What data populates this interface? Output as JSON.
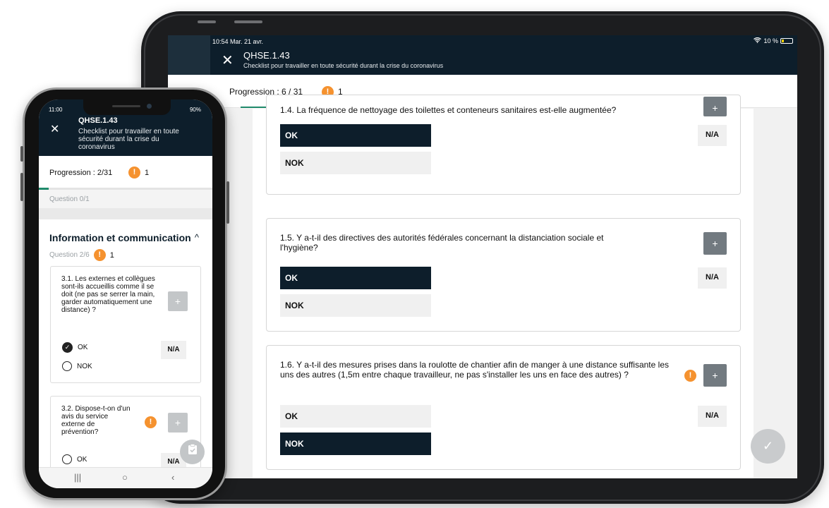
{
  "tablet": {
    "status": {
      "time_date": "10:54  Mar. 21 avr.",
      "battery": "10 %"
    },
    "header": {
      "title": "QHSE.1.43",
      "subtitle": "Checklist pour travailler en toute sécurité durant la crise du coronavirus"
    },
    "progress": {
      "label": "Progression : 6 / 31",
      "warnings": "1"
    },
    "questions": [
      {
        "text": "1.4. La fréquence de nettoyage des toilettes et conteneurs sanitaires est-elle augmentée?",
        "ok": "OK",
        "nok": "NOK",
        "na": "N/A",
        "selected": "OK"
      },
      {
        "text": "1.5. Y a-t-il des directives des autorités fédérales concernant la distanciation sociale et l'hygiène?",
        "ok": "OK",
        "nok": "NOK",
        "na": "N/A",
        "plus": "+",
        "selected": "OK"
      },
      {
        "text": "1.6. Y a-t-il des mesures prises dans la roulotte de chantier afin de manger à une distance suffisante les uns des autres (1,5m entre chaque travailleur, ne pas s'installer les uns en face des autres) ?",
        "ok": "OK",
        "nok": "NOK",
        "na": "N/A",
        "plus": "+",
        "selected": "NOK",
        "warning": "!"
      }
    ]
  },
  "phone": {
    "status": {
      "time": "11:00",
      "battery": "90%"
    },
    "header": {
      "title": "QHSE.1.43",
      "subtitle": "Checklist pour travailler en toute sécurité durant la crise du coronavirus"
    },
    "progress": {
      "label": "Progression : 2/31",
      "warnings": "1"
    },
    "question_counter": "Question 0/1",
    "section": {
      "title": "Information et communication",
      "counter": "Question 2/6",
      "warnings": "1"
    },
    "questions": [
      {
        "text": "3.1. Les externes et collègues sont-ils accueillis comme il se doit (ne pas se serrer la main, garder automatiquement une distance) ?",
        "ok": "OK",
        "nok": "NOK",
        "na": "N/A",
        "plus": "+",
        "selected": "OK"
      },
      {
        "text": "3.2. Dispose-t-on d'un avis du service externe de prévention?",
        "ok": "OK",
        "na": "N/A",
        "plus": "+",
        "warning": "!"
      }
    ]
  },
  "colors": {
    "navy": "#0d1e2b",
    "warning": "#f5922f",
    "progress": "#1f8a6b"
  }
}
